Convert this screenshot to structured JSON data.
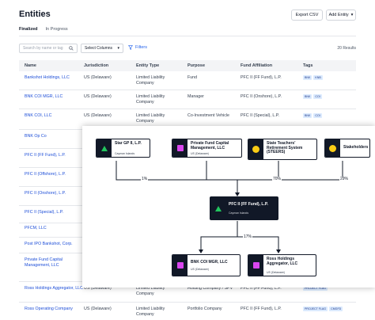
{
  "header": {
    "title": "Entities",
    "export_label": "Export CSV",
    "add_label": "Add Entity"
  },
  "tabs": [
    "Finalized",
    "In Progress"
  ],
  "toolbar": {
    "search_placeholder": "Search by name or tag",
    "select_columns_label": "Select Columns",
    "filters_label": "Filters",
    "results_label": "20 Results"
  },
  "table": {
    "columns": [
      "Name",
      "Jurisdiction",
      "Entity Type",
      "Purpose",
      "Fund Affiliation",
      "Tags"
    ],
    "rows": [
      {
        "name": "Bankshot Holdings, LLC",
        "jurisdiction": "US (Delaware)",
        "entity_type": "Limited Liability Company",
        "purpose": "Fund",
        "fund": "PFC II (FF Fund), L.P.",
        "tags": [
          "BNK",
          "KNB"
        ]
      },
      {
        "name": "BNK COI MGR, LLC",
        "jurisdiction": "US (Delaware)",
        "entity_type": "Limited Liability Company",
        "purpose": "Manager",
        "fund": "PFC II (Onshore), L.P.",
        "tags": [
          "BNK",
          "COI"
        ]
      },
      {
        "name": "BNK COI, LLC",
        "jurisdiction": "US (Delaware)",
        "entity_type": "Limited Liability Company",
        "purpose": "Co-Investment Vehicle",
        "fund": "PFC II (Special), L.P.",
        "tags": [
          "BNK",
          "COI"
        ]
      },
      {
        "name": "BNK Op Co",
        "jurisdiction": "",
        "entity_type": "",
        "purpose": "",
        "fund": "",
        "tags": []
      },
      {
        "name": "PFC II (FF Fund), L.P.",
        "jurisdiction": "",
        "entity_type": "",
        "purpose": "",
        "fund": "",
        "tags": []
      },
      {
        "name": "PFC II (Offshore), L.P.",
        "jurisdiction": "",
        "entity_type": "",
        "purpose": "",
        "fund": "",
        "tags": []
      },
      {
        "name": "PFC II (Onshore), L.P.",
        "jurisdiction": "",
        "entity_type": "",
        "purpose": "",
        "fund": "",
        "tags": []
      },
      {
        "name": "PFC II (Special), L.P.",
        "jurisdiction": "",
        "entity_type": "",
        "purpose": "",
        "fund": "",
        "tags": []
      },
      {
        "name": "PFCM, LLC",
        "jurisdiction": "",
        "entity_type": "",
        "purpose": "",
        "fund": "",
        "tags": []
      },
      {
        "name": "Post IPO Bankshot, Corp.",
        "jurisdiction": "",
        "entity_type": "",
        "purpose": "",
        "fund": "",
        "tags": []
      },
      {
        "name": "Private Fund Capital Management, LLC",
        "jurisdiction": "",
        "entity_type": "",
        "purpose": "",
        "fund": "",
        "tags": []
      },
      {
        "name": "Ross Holdings Aggregator, LLC",
        "jurisdiction": "US (Delaware)",
        "entity_type": "Limited Liability Company",
        "purpose": "Holding Company / SPV",
        "fund": "PFC II (FF Fund), L.P.",
        "tags": [
          "PROJECT FLAG"
        ]
      },
      {
        "name": "Ross Operating Company",
        "jurisdiction": "US (Delaware)",
        "entity_type": "Limited Liability Company",
        "purpose": "Portfolio Company",
        "fund": "PFC II (FF Fund), L.P.",
        "tags": [
          "PROJECT FLAG",
          "CMGFD"
        ]
      }
    ]
  },
  "diagram": {
    "nodes": {
      "star": {
        "name": "Star GP II, L.P.",
        "sub": "Cayman Islands"
      },
      "pfcm": {
        "name": "Private Fund Capital Management, LLC",
        "sub": "US (Delaware)"
      },
      "steers": {
        "name": "State Teachers' Retirement System (STEERS)",
        "sub": ""
      },
      "stake": {
        "name": "Stakeholders",
        "sub": ""
      },
      "pfc": {
        "name": "PFC II (FF Fund), L.P.",
        "sub": "Cayman Islands"
      },
      "bnk": {
        "name": "BNK COI MGR, LLC",
        "sub": "US (Delaware)"
      },
      "ross": {
        "name": "Ross Holdings Aggregator, LLC",
        "sub": "US (Delaware)"
      }
    },
    "percents": {
      "star": "1%",
      "steers": "70%",
      "stake": "29%",
      "bnk": "17%"
    }
  },
  "colors": {
    "accent": "#1d4ed8",
    "node_dark": "#111827",
    "triangle": "#22c55e",
    "square": "#d946ef",
    "circle": "#facc15",
    "tag_bg": "#dbeafe"
  }
}
